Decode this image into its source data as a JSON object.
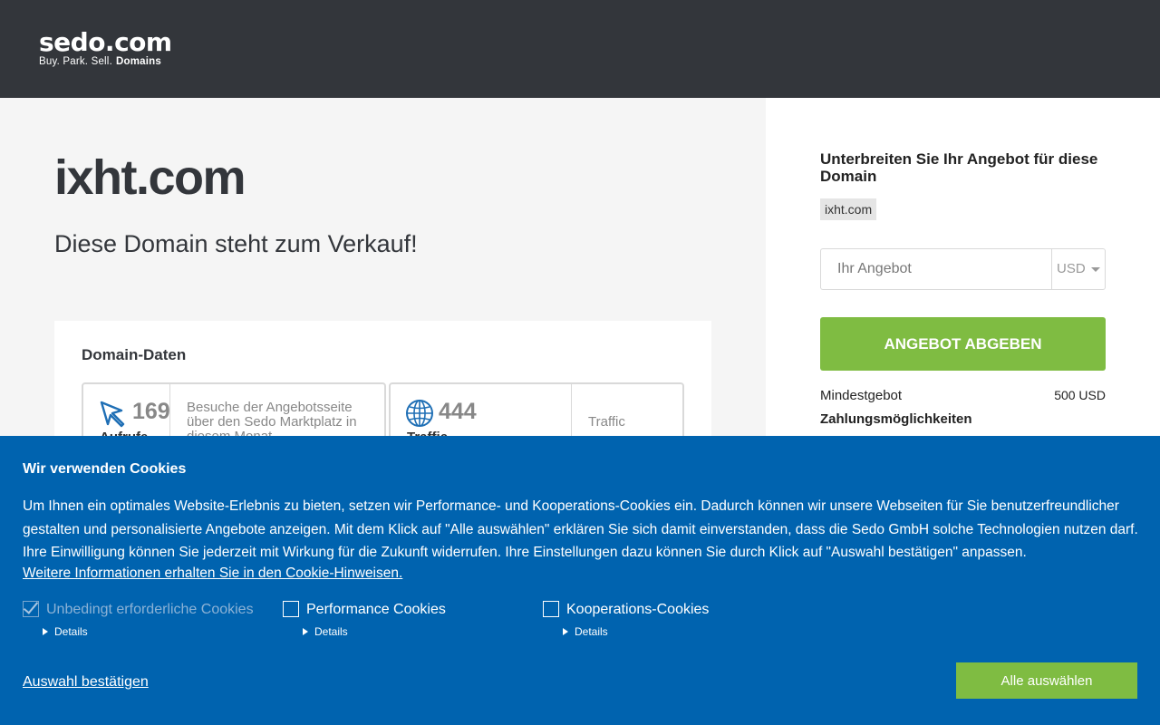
{
  "header": {
    "logo": "sedo.com",
    "tagline": "Buy. Park. Sell.",
    "tagline_bold": "Domains"
  },
  "main": {
    "domain": "ixht.com",
    "subtitle": "Diese Domain steht zum Verkauf!",
    "card": {
      "title": "Domain-Daten",
      "stats": [
        {
          "value": "169",
          "label": "Aufrufe",
          "description": "Besuche der Angebotsseite über den Sedo Marktplatz in diesem Monat",
          "icon": "cursor-icon"
        },
        {
          "value": "444",
          "label": "Traffic",
          "description": "Traffic",
          "icon": "globe-icon"
        }
      ]
    }
  },
  "offer": {
    "title": "Unterbreiten Sie Ihr Angebot für diese Domain",
    "domain_chip": "ixht.com",
    "placeholder": "Ihr Angebot",
    "currency": "USD",
    "submit_label": "ANGEBOT ABGEBEN",
    "min_label": "Mindestgebot",
    "min_value": "500 USD",
    "payment_label": "Zahlungsmöglichkeiten"
  },
  "cookie": {
    "title": "Wir verwenden Cookies",
    "text": "Um Ihnen ein optimales Website-Erlebnis zu bieten, setzen wir Performance- und Kooperations-Cookies ein. Dadurch können wir unsere Webseiten für Sie benutzerfreundlicher gestalten und personalisierte Angebote anzeigen. Mit dem Klick auf \"Alle auswählen\" erklären Sie sich damit einverstanden, dass die Sedo GmbH solche Technologien nutzen darf. Ihre Einwilligung können Sie jederzeit mit Wirkung für die Zukunft widerrufen. Ihre Einstellungen dazu können Sie durch Klick auf \"Auswahl bestätigen\" anpassen.",
    "info_link": "Weitere Informationen erhalten Sie in den Cookie-Hinweisen.",
    "options": [
      {
        "label": "Unbedingt erforderliche Cookies",
        "checked": true,
        "disabled": true,
        "details": "Details"
      },
      {
        "label": "Performance Cookies",
        "checked": false,
        "disabled": false,
        "details": "Details"
      },
      {
        "label": "Kooperations-Cookies",
        "checked": false,
        "disabled": false,
        "details": "Details"
      }
    ],
    "confirm_label": "Auswahl bestätigen",
    "select_all_label": "Alle auswählen"
  },
  "colors": {
    "header_bg": "#33363b",
    "accent_green": "#7fbc42",
    "cookie_blue": "#0063af",
    "icon_blue": "#1f6fb5"
  }
}
